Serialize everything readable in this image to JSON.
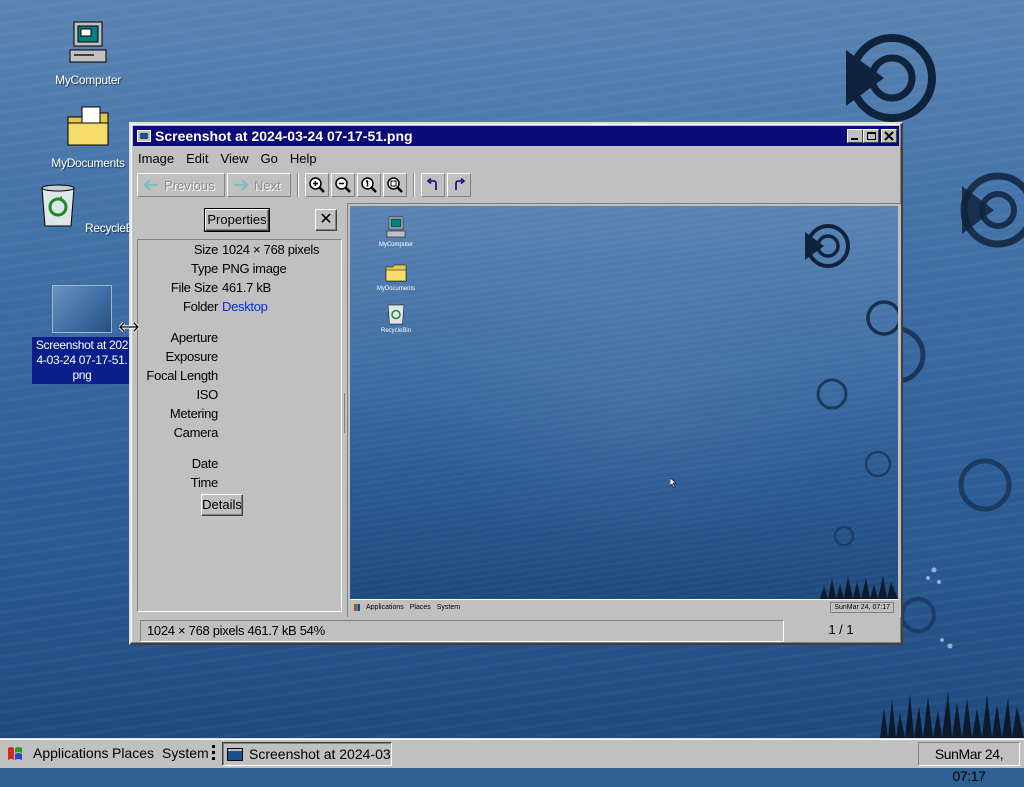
{
  "desktop": {
    "icons": [
      {
        "label": "MyComputer"
      },
      {
        "label": "MyDocuments"
      },
      {
        "label": "RecycleBin"
      },
      {
        "label": "Screenshot at 2024-03-24 07-17-51.png"
      }
    ]
  },
  "window": {
    "title": "Screenshot at 2024-03-24 07-17-51.png",
    "menu": [
      "Image",
      "Edit",
      "View",
      "Go",
      "Help"
    ],
    "toolbar": {
      "previous_label": "Previous",
      "next_label": "Next"
    },
    "properties": {
      "button_label": "Properties",
      "close_glyph": "✕",
      "rows": [
        {
          "key": "Size",
          "value": "1024 × 768 pixels"
        },
        {
          "key": "Type",
          "value": "PNG image"
        },
        {
          "key": "File Size",
          "value": "461.7 kB"
        },
        {
          "key": "Folder",
          "value": "Desktop"
        },
        {
          "key": "Aperture",
          "value": ""
        },
        {
          "key": "Exposure",
          "value": ""
        },
        {
          "key": "Focal Length",
          "value": ""
        },
        {
          "key": "ISO",
          "value": ""
        },
        {
          "key": "Metering",
          "value": ""
        },
        {
          "key": "Camera",
          "value": ""
        },
        {
          "key": "Date",
          "value": ""
        },
        {
          "key": "Time",
          "value": ""
        }
      ],
      "details_label": "Details"
    },
    "status": "1024 × 768 pixels  461.7 kB  54%",
    "page_info": "1 / 1",
    "preview": {
      "icons": [
        "MyComputer",
        "MyDocuments",
        "RecycleBin"
      ],
      "taskbar": [
        "Applications",
        "Places",
        "System"
      ],
      "clock": "SunMar 24, 07:17"
    }
  },
  "taskbar": {
    "applications": "Applications",
    "places": "Places",
    "system": "System",
    "task_title": "Screenshot at 2024-03-...",
    "clock": "SunMar 24, 07:17"
  }
}
